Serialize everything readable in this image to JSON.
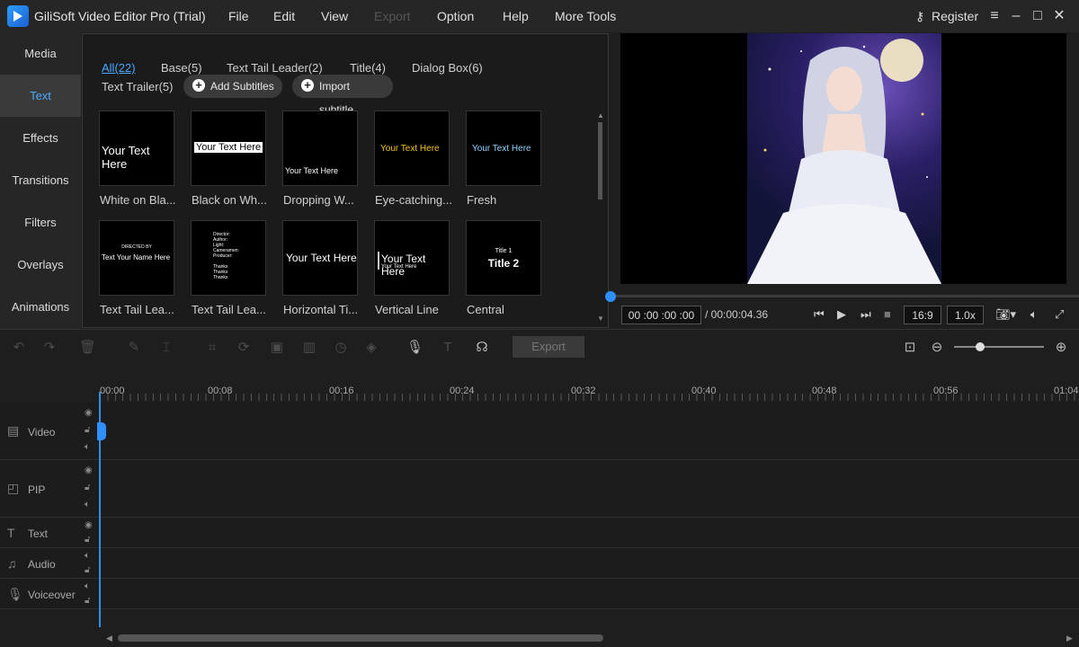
{
  "window": {
    "title": "GiliSoft Video Editor Pro (Trial)",
    "menu": [
      "File",
      "Edit",
      "View",
      "Export",
      "Option",
      "Help",
      "More Tools"
    ],
    "register_label": "Register"
  },
  "leftnav": {
    "items": [
      "Media",
      "Text",
      "Effects",
      "Transitions",
      "Filters",
      "Overlays",
      "Animations"
    ],
    "active": "Text"
  },
  "library": {
    "tabs": [
      "All(22)",
      "Base(5)",
      "Text Tail Leader(2)",
      "Title(4)",
      "Dialog Box(6)",
      "Text Trailer(5)"
    ],
    "add_subtitles": "Add Subtitles",
    "import_subtitle": "Import subtitle",
    "items": [
      {
        "label": "White on Bla...",
        "preview": "Your Text Here"
      },
      {
        "label": "Black on Wh...",
        "preview": "Your Text Here"
      },
      {
        "label": "Dropping W...",
        "preview": "Your Text Here"
      },
      {
        "label": "Eye-catching...",
        "preview": "Your Text Here"
      },
      {
        "label": "Fresh",
        "preview": "Your Text Here"
      },
      {
        "label": "Text Tail Lea...",
        "preview": "Text Your Name Here",
        "preview_small": "DIRECTED BY"
      },
      {
        "label": "Text Tail Lea...",
        "preview_lines": [
          "Director:",
          "Author:",
          "Light:",
          "Cameramen:",
          "Producer:",
          "",
          "Thanks",
          "Thanks",
          "Thanks"
        ]
      },
      {
        "label": "Horizontal Ti...",
        "preview": "Your Text Here"
      },
      {
        "label": "Vertical Line",
        "preview": "Your Text Here",
        "preview_small": "Your Text Here"
      },
      {
        "label": "Central",
        "preview_small": "Title 1",
        "preview": "Title 2"
      }
    ]
  },
  "preview": {
    "current_time": "00 :00 :00 :00",
    "total_time": "/ 00:00:04.36",
    "aspect": "16:9",
    "speed": "1.0x"
  },
  "toolbar": {
    "export_label": "Export"
  },
  "timeline": {
    "ruler": [
      "00:00",
      "00:08",
      "00:16",
      "00:24",
      "00:32",
      "00:40",
      "00:48",
      "00:56",
      "01:04"
    ],
    "tracks": [
      "Video",
      "PIP",
      "Text",
      "Audio",
      "Voiceover"
    ]
  },
  "colors": {
    "accent": "#2f8fff",
    "active_nav_text": "#4aa8ff",
    "background": "#1e1e1e"
  }
}
